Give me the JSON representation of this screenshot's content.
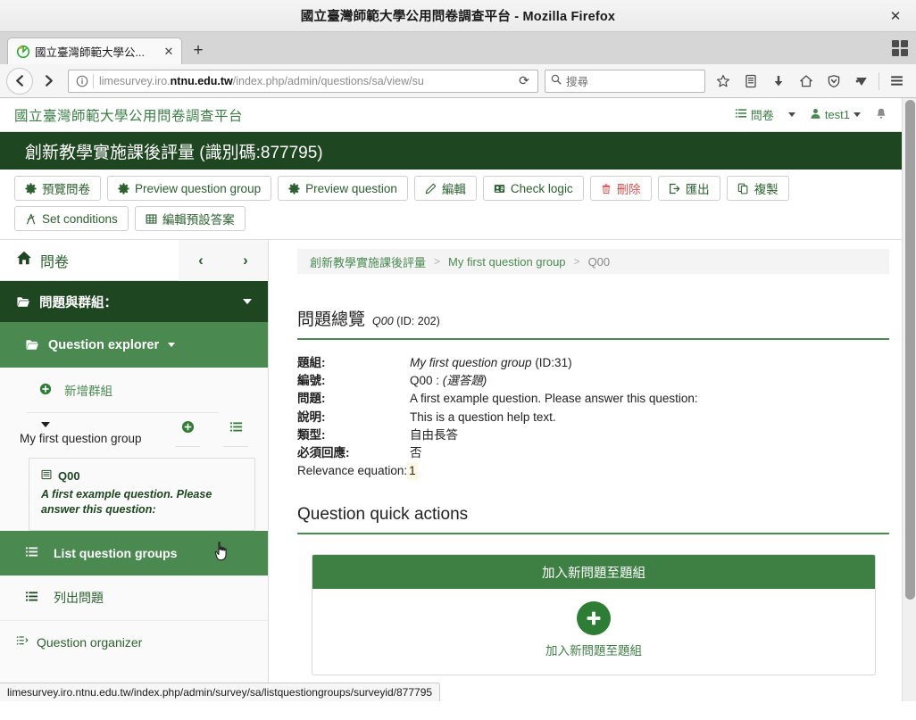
{
  "browser": {
    "window_title": "國立臺灣師範大學公用問卷調查平台 - Mozilla Firefox",
    "close_glyph": "✕",
    "tab": {
      "title": "國立臺灣師範大學公...",
      "close_glyph": "✕",
      "favicon": "firefox-icon"
    },
    "new_tab_glyph": "+",
    "url": {
      "prefix": "limesurvey.iro.",
      "host_bold": "ntnu.edu.tw",
      "path": "/index.php/admin/questions/sa/view/su",
      "identity_icon": "info-circle-icon",
      "reload_glyph": "⟳"
    },
    "search": {
      "placeholder": "搜尋",
      "icon": "search-icon"
    },
    "toolbar_icons": [
      "bookmark-star-icon",
      "library-icon",
      "downloads-icon",
      "home-icon",
      "shield-icon",
      "pocket-icon",
      "hamburger-menu-icon"
    ],
    "status_link": "limesurvey.iro.ntnu.edu.tw/index.php/admin/survey/sa/listquestiongroups/surveyid/877795"
  },
  "app": {
    "brand": "國立臺灣師範大學公用問卷調查平台",
    "topbar": {
      "surveys_label": "問卷",
      "surveys_icon": "list-icon",
      "user_label": "test1",
      "user_icon": "user-icon",
      "notification_icon": "bell-icon"
    },
    "survey_title": "創新教學實施課後評量 (識別碼:877795)"
  },
  "toolbar": {
    "buttons": [
      {
        "label": "預覽問卷",
        "icon": "gear-icon",
        "style": "normal"
      },
      {
        "label": "Preview question group",
        "icon": "gear-icon",
        "style": "normal"
      },
      {
        "label": "Preview question",
        "icon": "gear-icon",
        "style": "normal"
      },
      {
        "label": "編輯",
        "icon": "pencil-icon",
        "style": "normal"
      },
      {
        "label": "Check logic",
        "icon": "logic-badge-icon",
        "style": "normal"
      },
      {
        "label": "刪除",
        "icon": "trash-icon",
        "style": "danger"
      },
      {
        "label": "匯出",
        "icon": "export-icon",
        "style": "normal"
      },
      {
        "label": "複製",
        "icon": "copy-icon",
        "style": "normal"
      },
      {
        "label": "Set conditions",
        "icon": "conditions-icon",
        "style": "normal"
      },
      {
        "label": "編輯預設答案",
        "icon": "table-icon",
        "style": "normal"
      }
    ]
  },
  "sidebar": {
    "home_label": "問卷",
    "home_icon": "home-icon",
    "prev_glyph": "‹",
    "next_glyph": "›",
    "section_head": "問題與群組：",
    "section_head_icon": "folder-open-icon",
    "question_explorer": "Question explorer",
    "question_explorer_icon": "folder-open-icon",
    "add_group_label": "新增群組",
    "add_group_icon": "plus-circle-icon",
    "group_name": "My first question group",
    "group_add_icon": "plus-circle-icon",
    "group_list_icon": "list-icon",
    "question_card": {
      "code": "Q00",
      "icon": "question-list-icon",
      "text": "A first example question. Please answer this question:"
    },
    "links": [
      {
        "label": "List question groups",
        "icon": "list-icon",
        "active": true
      },
      {
        "label": "列出問題",
        "icon": "list-icon",
        "active": false
      },
      {
        "label": "Question organizer",
        "icon": "organizer-icon",
        "active": false
      }
    ]
  },
  "main": {
    "breadcrumb": [
      "創新教學實施課後評量",
      "My first question group",
      "Q00"
    ],
    "breadcrumb_separator": ">",
    "overview": {
      "title": "問題總覽",
      "code": "Q00",
      "id_text": "(ID: 202)"
    },
    "details": [
      {
        "label": "題組:",
        "value": "My first question group",
        "value_suffix": " (ID:31)",
        "italic": true
      },
      {
        "label": "編號:",
        "value": "Q00 : ",
        "value_suffix": "(選答題)",
        "italic": false
      },
      {
        "label": "問題:",
        "value": "A first example question. Please answer this question:",
        "value_suffix": "",
        "italic": false
      },
      {
        "label": "說明:",
        "value": "This is a question help text.",
        "value_suffix": "",
        "italic": false
      },
      {
        "label": "類型:",
        "value": "自由長答",
        "value_suffix": "",
        "italic": false
      },
      {
        "label": "必須回應:",
        "value": "否",
        "value_suffix": "",
        "italic": false
      }
    ],
    "relevance": {
      "label": "Relevance equation:",
      "value": "1"
    },
    "quick_actions_title": "Question quick actions",
    "action_panel": {
      "header": "加入新問題至題組",
      "label": "加入新問題至題組",
      "plus_glyph": "+"
    }
  },
  "colors": {
    "dark_green": "#1e4620",
    "mid_green": "#4a8a51",
    "accent_green": "#3e8044",
    "link_green": "#2c602f",
    "danger_red": "#d9534f",
    "highlight_yellow": "#fcf8e3"
  }
}
